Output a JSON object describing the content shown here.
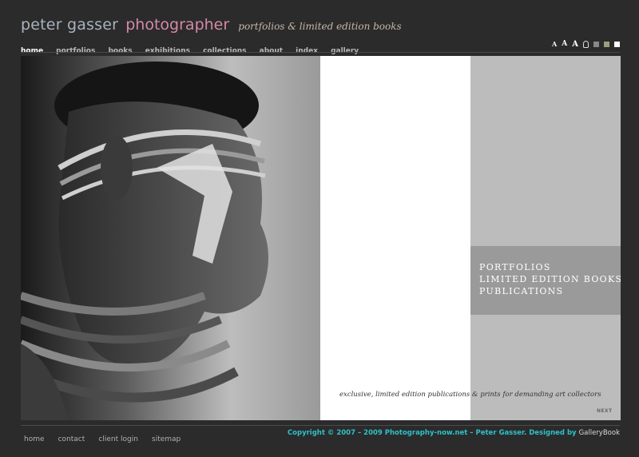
{
  "header": {
    "name": "peter gasser",
    "role": "photographer",
    "tagline": "portfolios & limited edition books"
  },
  "nav": {
    "items": [
      "home",
      "portfolios",
      "books",
      "exhibitions",
      "collections",
      "about",
      "index",
      "gallery"
    ]
  },
  "tools": {
    "text_size_labels": [
      "A",
      "A",
      "A"
    ],
    "swatches": [
      "#888888",
      "#9aa07a",
      "#ffffff"
    ]
  },
  "hero": {
    "menu": [
      "PORTFOLIOS",
      "LIMITED EDITION BOOKS",
      "PUBLICATIONS"
    ],
    "caption": "exclusive, limited edition publications & prints for demanding art collectors",
    "next_label": "NEXT"
  },
  "footer": {
    "links": [
      "home",
      "contact",
      "client login",
      "sitemap"
    ],
    "copyright": "Copyright © 2007 – 2009 Photography-now.net – Peter Gasser. Designed by",
    "designer": "GalleryBook"
  },
  "colors": {
    "background": "#2b2b2b",
    "name": "#a8b2bd",
    "role": "#d489a6",
    "copyright": "#2fc0c8"
  }
}
